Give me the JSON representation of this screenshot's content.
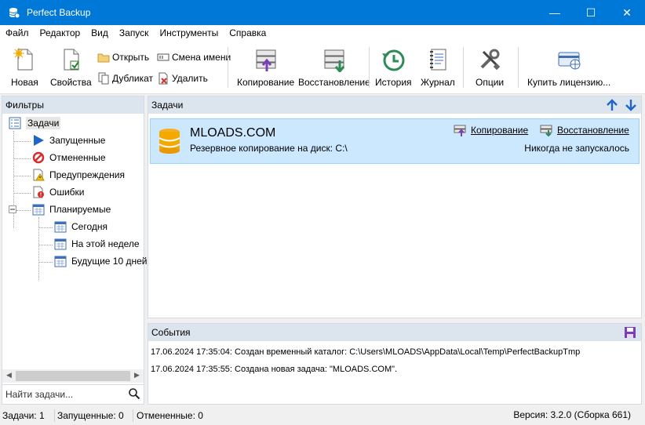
{
  "window": {
    "title": "Perfect Backup",
    "min": "—",
    "max": "☐",
    "close": "✕"
  },
  "menu": [
    "Файл",
    "Редактор",
    "Вид",
    "Запуск",
    "Инструменты",
    "Справка"
  ],
  "toolbar": {
    "new": "Новая",
    "properties": "Свойства",
    "open": "Открыть",
    "duplicate": "Дубликат",
    "rename": "Смена имени",
    "delete": "Удалить",
    "copy": "Копирование",
    "restore": "Восстановление",
    "history": "История",
    "journal": "Журнал",
    "options": "Опции",
    "buy": "Купить лицензию..."
  },
  "filters": {
    "header": "Фильтры",
    "root": "Задачи",
    "items": [
      "Запущенные",
      "Отмененные",
      "Предупреждения",
      "Ошибки",
      "Планируемые"
    ],
    "scheduled": [
      "Сегодня",
      "На этой неделе",
      "Будущие 10 дней"
    ],
    "search_placeholder": "Найти задачи..."
  },
  "tasks": {
    "header": "Задачи",
    "items": [
      {
        "name": "MLOADS.COM",
        "description": "Резервное копирование на диск: C:\\",
        "copy_link": "Копирование",
        "restore_link": "Восстановление",
        "status": "Никогда не запускалось"
      }
    ]
  },
  "events": {
    "header": "События",
    "items": [
      "17.06.2024 17:35:04: Создан временный каталог: C:\\Users\\MLOADS\\AppData\\Local\\Temp\\PerfectBackupTmp",
      "17.06.2024 17:35:55: Создана новая задача: \"MLOADS.COM\"."
    ]
  },
  "statusbar": {
    "tasks": "Задачи: 1",
    "running": "Запущенные: 0",
    "cancelled": "Отмененные: 0",
    "version": "Версия: 3.2.0 (Сборка 661)"
  },
  "colors": {
    "accent": "#0078d7",
    "selection": "#cce8ff",
    "header": "#dce4ee"
  }
}
